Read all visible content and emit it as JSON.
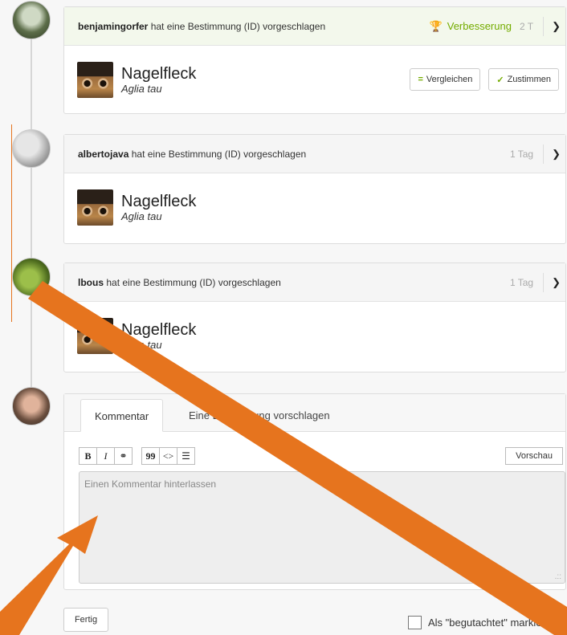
{
  "observations": [
    {
      "user": "benjamingorfer",
      "action": "hat eine Bestimmung (ID) vorgeschlagen",
      "badge": "Verbesserung",
      "time": "2 T",
      "taxon_common": "Nagelfleck",
      "taxon_sci": "Aglia tau",
      "compare_label": "Vergleichen",
      "agree_label": "Zustimmen"
    },
    {
      "user": "albertojava",
      "action": "hat eine Bestimmung (ID) vorgeschlagen",
      "time": "1 Tag",
      "taxon_common": "Nagelfleck",
      "taxon_sci": "Aglia tau"
    },
    {
      "user": "lbous",
      "action": "hat eine Bestimmung (ID) vorgeschlagen",
      "time": "1 Tag",
      "taxon_common": "Nagelfleck",
      "taxon_sci": "Aglia tau"
    }
  ],
  "composer": {
    "tab_comment": "Kommentar",
    "tab_suggest": "Eine Bestimmung vorschlagen",
    "toolbar": {
      "bold": "B",
      "italic": "I",
      "link": "⚭",
      "quote": "99",
      "code": "<>",
      "list": "☰"
    },
    "preview_label": "Vorschau",
    "placeholder": "Einen Kommentar hinterlassen",
    "done_label": "Fertig",
    "reviewed_label": "Als \"begutachtet\" markieren"
  },
  "colors": {
    "accent_green": "#74ac00",
    "annotation_orange": "#e6741e"
  }
}
